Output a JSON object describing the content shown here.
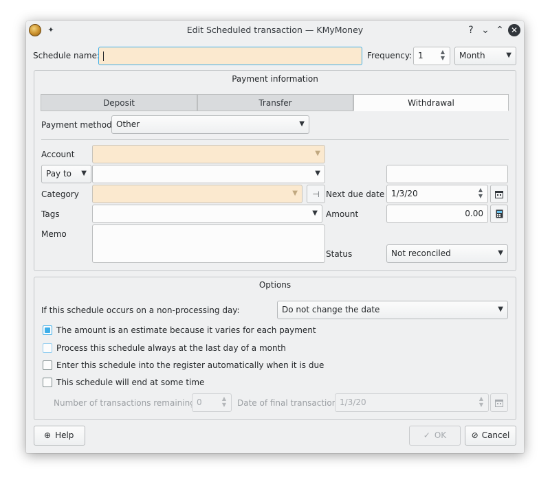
{
  "window": {
    "title": "Edit Scheduled transaction — KMyMoney",
    "help_glyph": "?",
    "minimize_glyph": "⌄",
    "maximize_glyph": "⌃",
    "close_glyph": "✕",
    "pin_glyph": "✦"
  },
  "header": {
    "schedule_name_label": "Schedule name:",
    "schedule_name_value": "",
    "frequency_label": "Frequency:",
    "frequency_number": "1",
    "frequency_unit": "Month"
  },
  "payment": {
    "group_title": "Payment information",
    "tabs": [
      {
        "label": "Deposit",
        "active": false
      },
      {
        "label": "Transfer",
        "active": false
      },
      {
        "label": "Withdrawal",
        "active": true
      }
    ],
    "method_label": "Payment method",
    "method_value": "Other",
    "account_label": "Account",
    "account_value": "",
    "payto_selector": "Pay to",
    "payto_value": "",
    "number_value": "",
    "category_label": "Category",
    "category_value": "",
    "tags_label": "Tags",
    "tags_value": "",
    "memo_label": "Memo",
    "memo_value": "",
    "next_due_label": "Next due date",
    "next_due_value": "1/3/20",
    "amount_label": "Amount",
    "amount_value": "0.00",
    "status_label": "Status",
    "status_value": "Not reconciled"
  },
  "options": {
    "group_title": "Options",
    "nonprocessing_label": "If this schedule occurs on a non-processing day:",
    "nonprocessing_value": "Do not change the date",
    "checkboxes": [
      {
        "label": "The amount is an estimate because it varies for each payment",
        "checked": true
      },
      {
        "label": "Process this schedule always at the last day of a month",
        "checked": false
      },
      {
        "label": "Enter this schedule into the register automatically when it is due",
        "checked": false
      },
      {
        "label": "This schedule will end at some time",
        "checked": false
      }
    ],
    "remaining_label": "Number of transactions remaining:",
    "remaining_value": "0",
    "final_date_label": "Date of final transaction:",
    "final_date_value": "1/3/20"
  },
  "buttons": {
    "help_label": "Help",
    "ok_label": "OK",
    "cancel_label": "Cancel"
  },
  "colors": {
    "required_field": "#fbe9cf",
    "focus_accent": "#3daee9",
    "window_bg": "#eff0f1"
  }
}
